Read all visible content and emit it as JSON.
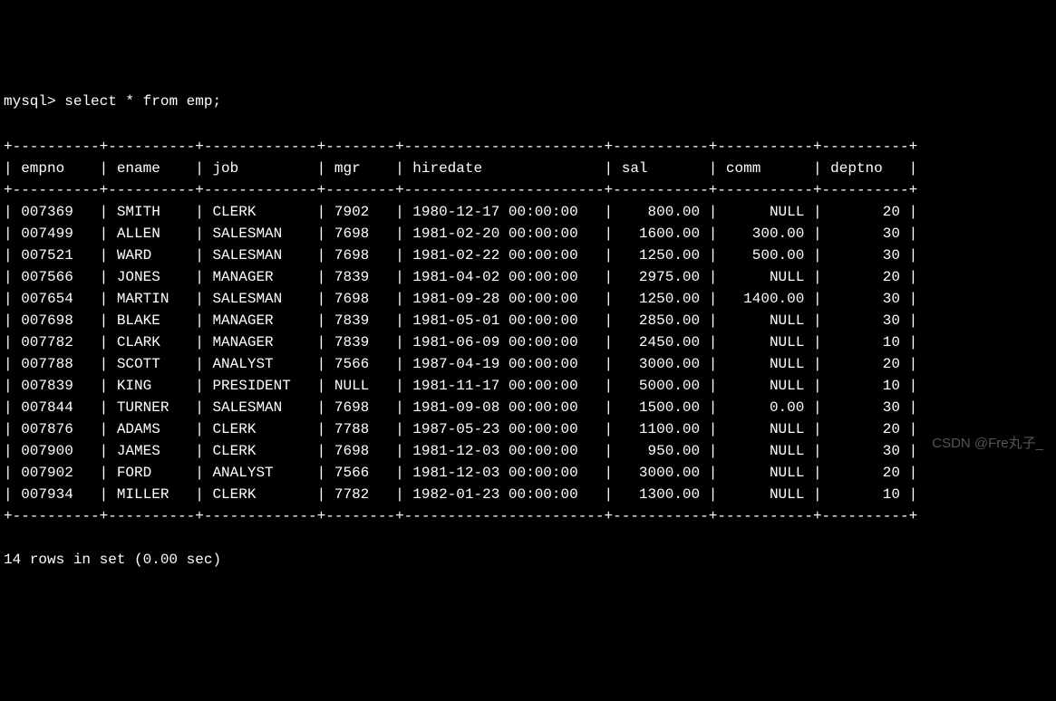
{
  "prompt": "mysql> ",
  "query": "select * from emp;",
  "columns": [
    "empno",
    "ename",
    "job",
    "mgr",
    "hiredate",
    "sal",
    "comm",
    "deptno"
  ],
  "widths": [
    8,
    8,
    11,
    6,
    21,
    9,
    9,
    8
  ],
  "aligns": [
    "left",
    "left",
    "left",
    "left",
    "left",
    "right",
    "right",
    "right"
  ],
  "rows": [
    [
      "007369",
      "SMITH",
      "CLERK",
      "7902",
      "1980-12-17 00:00:00",
      "800.00",
      "NULL",
      "20"
    ],
    [
      "007499",
      "ALLEN",
      "SALESMAN",
      "7698",
      "1981-02-20 00:00:00",
      "1600.00",
      "300.00",
      "30"
    ],
    [
      "007521",
      "WARD",
      "SALESMAN",
      "7698",
      "1981-02-22 00:00:00",
      "1250.00",
      "500.00",
      "30"
    ],
    [
      "007566",
      "JONES",
      "MANAGER",
      "7839",
      "1981-04-02 00:00:00",
      "2975.00",
      "NULL",
      "20"
    ],
    [
      "007654",
      "MARTIN",
      "SALESMAN",
      "7698",
      "1981-09-28 00:00:00",
      "1250.00",
      "1400.00",
      "30"
    ],
    [
      "007698",
      "BLAKE",
      "MANAGER",
      "7839",
      "1981-05-01 00:00:00",
      "2850.00",
      "NULL",
      "30"
    ],
    [
      "007782",
      "CLARK",
      "MANAGER",
      "7839",
      "1981-06-09 00:00:00",
      "2450.00",
      "NULL",
      "10"
    ],
    [
      "007788",
      "SCOTT",
      "ANALYST",
      "7566",
      "1987-04-19 00:00:00",
      "3000.00",
      "NULL",
      "20"
    ],
    [
      "007839",
      "KING",
      "PRESIDENT",
      "NULL",
      "1981-11-17 00:00:00",
      "5000.00",
      "NULL",
      "10"
    ],
    [
      "007844",
      "TURNER",
      "SALESMAN",
      "7698",
      "1981-09-08 00:00:00",
      "1500.00",
      "0.00",
      "30"
    ],
    [
      "007876",
      "ADAMS",
      "CLERK",
      "7788",
      "1987-05-23 00:00:00",
      "1100.00",
      "NULL",
      "20"
    ],
    [
      "007900",
      "JAMES",
      "CLERK",
      "7698",
      "1981-12-03 00:00:00",
      "950.00",
      "NULL",
      "30"
    ],
    [
      "007902",
      "FORD",
      "ANALYST",
      "7566",
      "1981-12-03 00:00:00",
      "3000.00",
      "NULL",
      "20"
    ],
    [
      "007934",
      "MILLER",
      "CLERK",
      "7782",
      "1982-01-23 00:00:00",
      "1300.00",
      "NULL",
      "10"
    ]
  ],
  "footer": "14 rows in set (0.00 sec)",
  "watermark": "CSDN @Fre丸子_"
}
